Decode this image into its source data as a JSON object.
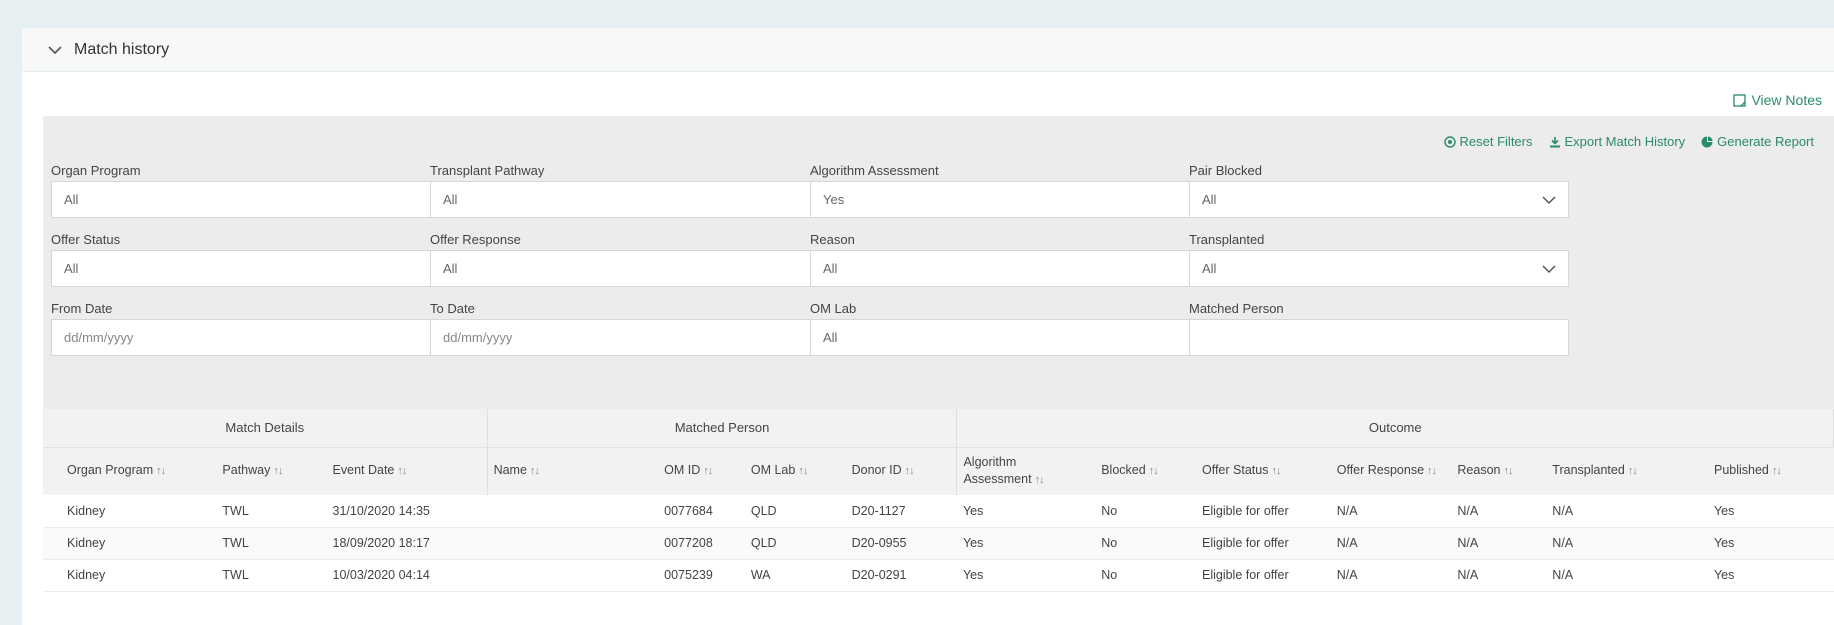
{
  "panel": {
    "title": "Match history"
  },
  "view_notes": "View Notes",
  "actions": {
    "reset": "Reset Filters",
    "export": "Export Match History",
    "report": "Generate Report"
  },
  "filters": {
    "organ_program": {
      "label": "Organ Program",
      "value": "All"
    },
    "transplant_pathway": {
      "label": "Transplant Pathway",
      "value": "All"
    },
    "algorithm_assessment": {
      "label": "Algorithm Assessment",
      "value": "Yes"
    },
    "pair_blocked": {
      "label": "Pair Blocked",
      "value": "All"
    },
    "offer_status": {
      "label": "Offer Status",
      "value": "All"
    },
    "offer_response": {
      "label": "Offer Response",
      "value": "All"
    },
    "reason": {
      "label": "Reason",
      "value": "All"
    },
    "transplanted": {
      "label": "Transplanted",
      "value": "All"
    },
    "from_date": {
      "label": "From Date",
      "placeholder": "dd/mm/yyyy"
    },
    "to_date": {
      "label": "To Date",
      "placeholder": "dd/mm/yyyy"
    },
    "om_lab": {
      "label": "OM Lab",
      "value": "All"
    },
    "matched_person": {
      "label": "Matched Person",
      "value": ""
    }
  },
  "table": {
    "groups": [
      "Match Details",
      "Matched Person",
      "Outcome"
    ],
    "columns": [
      "Organ Program",
      "Pathway",
      "Event Date",
      "Name",
      "OM ID",
      "OM Lab",
      "Donor ID",
      "Algorithm Assessment",
      "Blocked",
      "Offer Status",
      "Offer Response",
      "Reason",
      "Transplanted",
      "Published"
    ],
    "sort_glyph": "↑↓",
    "rows": [
      [
        "Kidney",
        "TWL",
        "31/10/2020 14:35",
        "",
        "0077684",
        "QLD",
        "D20-1127",
        "Yes",
        "No",
        "Eligible for offer",
        "N/A",
        "N/A",
        "N/A",
        "Yes"
      ],
      [
        "Kidney",
        "TWL",
        "18/09/2020 18:17",
        "",
        "0077208",
        "QLD",
        "D20-0955",
        "Yes",
        "No",
        "Eligible for offer",
        "N/A",
        "N/A",
        "N/A",
        "Yes"
      ],
      [
        "Kidney",
        "TWL",
        "10/03/2020 04:14",
        "",
        "0075239",
        "WA",
        "D20-0291",
        "Yes",
        "No",
        "Eligible for offer",
        "N/A",
        "N/A",
        "N/A",
        "Yes"
      ]
    ]
  },
  "colors": {
    "accent": "#2a8a6e",
    "background": "#e6eff1",
    "filter_bg": "#ececec"
  }
}
